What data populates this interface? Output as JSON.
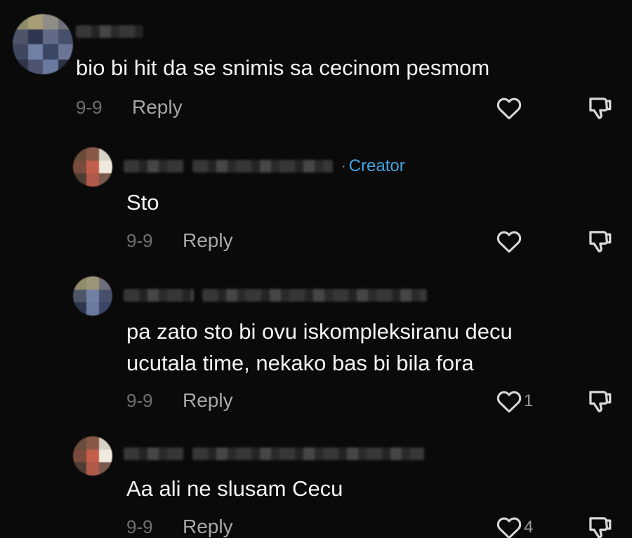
{
  "comments": [
    {
      "username": "",
      "creator_label": "",
      "text": "bio bi hit da se snimis sa cecinom pesmom",
      "date": "9-9",
      "reply_label": "Reply",
      "like_count": "",
      "icons": {
        "like": "heart-icon",
        "dislike": "thumbs-down-icon"
      }
    },
    {
      "username": "",
      "creator_label": "Creator",
      "text": "Sto",
      "date": "9-9",
      "reply_label": "Reply",
      "like_count": "",
      "icons": {
        "like": "heart-icon",
        "dislike": "thumbs-down-icon"
      }
    },
    {
      "username": "",
      "creator_label": "",
      "text": "pa zato sto bi ovu iskompleksiranu decu\nucutala time, nekako bas bi bila fora",
      "date": "9-9",
      "reply_label": "Reply",
      "like_count": "1",
      "icons": {
        "like": "heart-icon",
        "dislike": "thumbs-down-icon"
      }
    },
    {
      "username": "",
      "creator_label": "",
      "text": "Aa ali ne slusam Cecu",
      "date": "9-9",
      "reply_label": "Reply",
      "like_count": "4",
      "icons": {
        "like": "heart-icon",
        "dislike": "thumbs-down-icon"
      }
    }
  ],
  "colors": {
    "background": "#0a0a0a",
    "text": "#f3f3f3",
    "creator_accent": "#45a4e0",
    "meta": "#6f6f6f",
    "icon": "#d8d8d8"
  }
}
